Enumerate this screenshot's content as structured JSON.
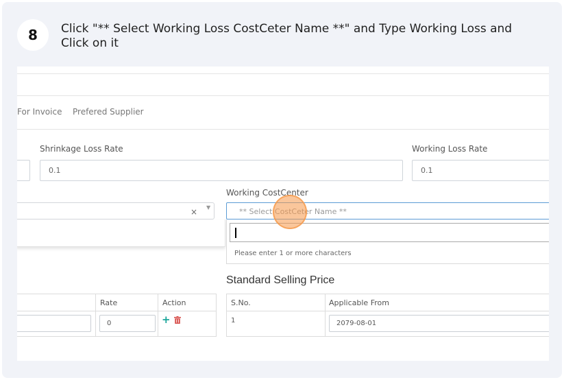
{
  "step": {
    "number": "8",
    "instruction": "Click \"** Select Working Loss CostCeter Name **\" and Type Working Loss and Click on it"
  },
  "screen": {
    "tabs": [
      "For Invoice",
      "Prefered Supplier"
    ],
    "shrinkage": {
      "label": "Shrinkage Loss Rate",
      "value": "0.1"
    },
    "working_loss": {
      "label": "Working Loss Rate",
      "value": "0.1"
    },
    "left_select": {
      "clear": "×",
      "caret": "▼"
    },
    "working_costcenter": {
      "label": "Working CostCenter",
      "placeholder": "** Select CostCeter Name **",
      "search_value": "",
      "dropdown_message": "Please enter 1 or more characters"
    },
    "standard_selling_price": {
      "title": "Standard Selling Price"
    },
    "left_table": {
      "headers": [
        "Rate",
        "Action"
      ],
      "row": {
        "rate": "0"
      }
    },
    "right_table": {
      "headers": [
        "S.No.",
        "Applicable From"
      ],
      "row": {
        "sno": "1",
        "applicable_from": "2079-08-01"
      }
    }
  },
  "colors": {
    "highlight": "#f59848",
    "focus_border": "#5b9bd5",
    "add_icon": "#1aa59a",
    "delete_icon": "#d9534f"
  }
}
